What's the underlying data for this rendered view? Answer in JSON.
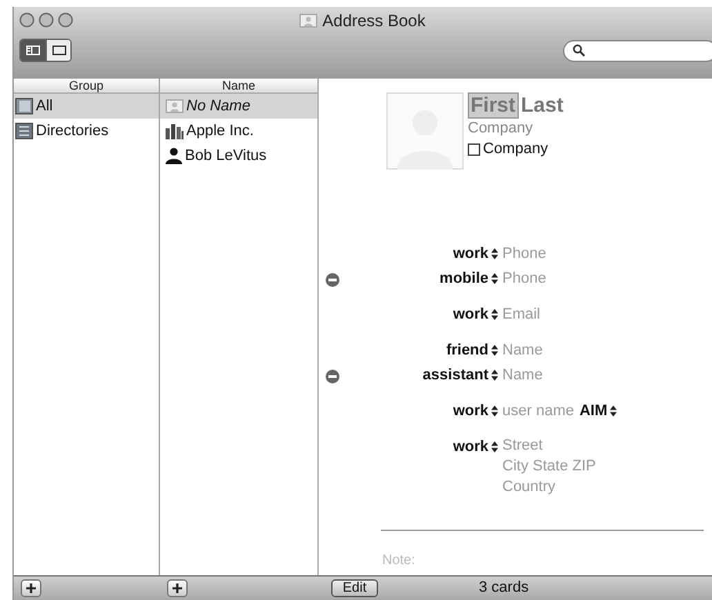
{
  "window": {
    "title": "Address Book"
  },
  "view_buttons": [
    {
      "kind": "columns",
      "selected": true
    },
    {
      "kind": "card",
      "selected": false
    }
  ],
  "groups": {
    "header": "Group",
    "items": [
      {
        "label": "All",
        "kind": "all",
        "selected": true
      },
      {
        "label": "Directories",
        "kind": "directory",
        "selected": false
      }
    ]
  },
  "names": {
    "header": "Name",
    "items": [
      {
        "label": "No Name",
        "kind": "card",
        "unnamed": true,
        "selected": true
      },
      {
        "label": "Apple Inc.",
        "kind": "company",
        "unnamed": false,
        "selected": false
      },
      {
        "label": "Bob LeVitus",
        "kind": "person",
        "unnamed": false,
        "selected": false
      }
    ]
  },
  "card": {
    "first_name": "First",
    "last_name": "Last",
    "company": "Company",
    "company_checkbox": {
      "label": "Company",
      "checked": false
    },
    "field_groups": [
      [
        {
          "label": "work",
          "value": "Phone",
          "removable": false
        },
        {
          "label": "mobile",
          "value": "Phone",
          "removable": true
        }
      ],
      [
        {
          "label": "work",
          "value": "Email",
          "removable": false
        }
      ],
      [
        {
          "label": "friend",
          "value": "Name",
          "removable": false
        },
        {
          "label": "assistant",
          "value": "Name",
          "removable": true
        }
      ],
      [
        {
          "label": "work",
          "value": "user name",
          "service": "AIM",
          "removable": false
        }
      ],
      [
        {
          "label": "work",
          "lines": [
            "Street",
            "City State ZIP",
            "Country"
          ],
          "removable": false
        }
      ]
    ],
    "note_label": "Note:"
  },
  "status_bar": {
    "edit_button": "Edit",
    "count": "3 cards"
  }
}
